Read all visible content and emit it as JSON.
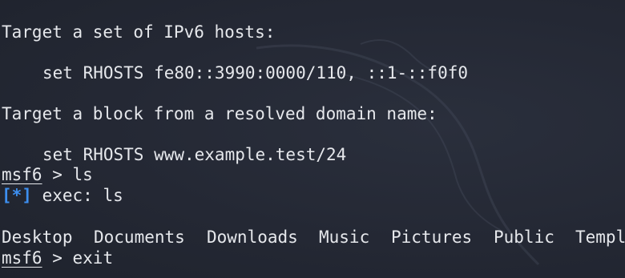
{
  "terminal": {
    "help_heading_ipv6": "Target a set of IPv6 hosts:",
    "help_example_ipv6": "set RHOSTS fe80::3990:0000/110, ::1-::f0f0",
    "help_heading_domain": "Target a block from a resolved domain name:",
    "help_example_domain": "set RHOSTS www.example.test/24",
    "prompt_1": "msf6",
    "prompt_1_sep": " > ",
    "command_1": "ls",
    "info_marker": "[*]",
    "exec_text": " exec: ls",
    "ls_output": [
      "Desktop",
      "Documents",
      "Downloads",
      "Music",
      "Pictures",
      "Public",
      "Templ"
    ],
    "prompt_2": "msf6",
    "prompt_2_sep": " > ",
    "command_2": "exit"
  },
  "colors": {
    "background": "#242834",
    "text": "#e6e8ec",
    "info_marker": "#3d8ff0"
  },
  "icons": {
    "background_watermark": "kali-dragon-icon"
  }
}
